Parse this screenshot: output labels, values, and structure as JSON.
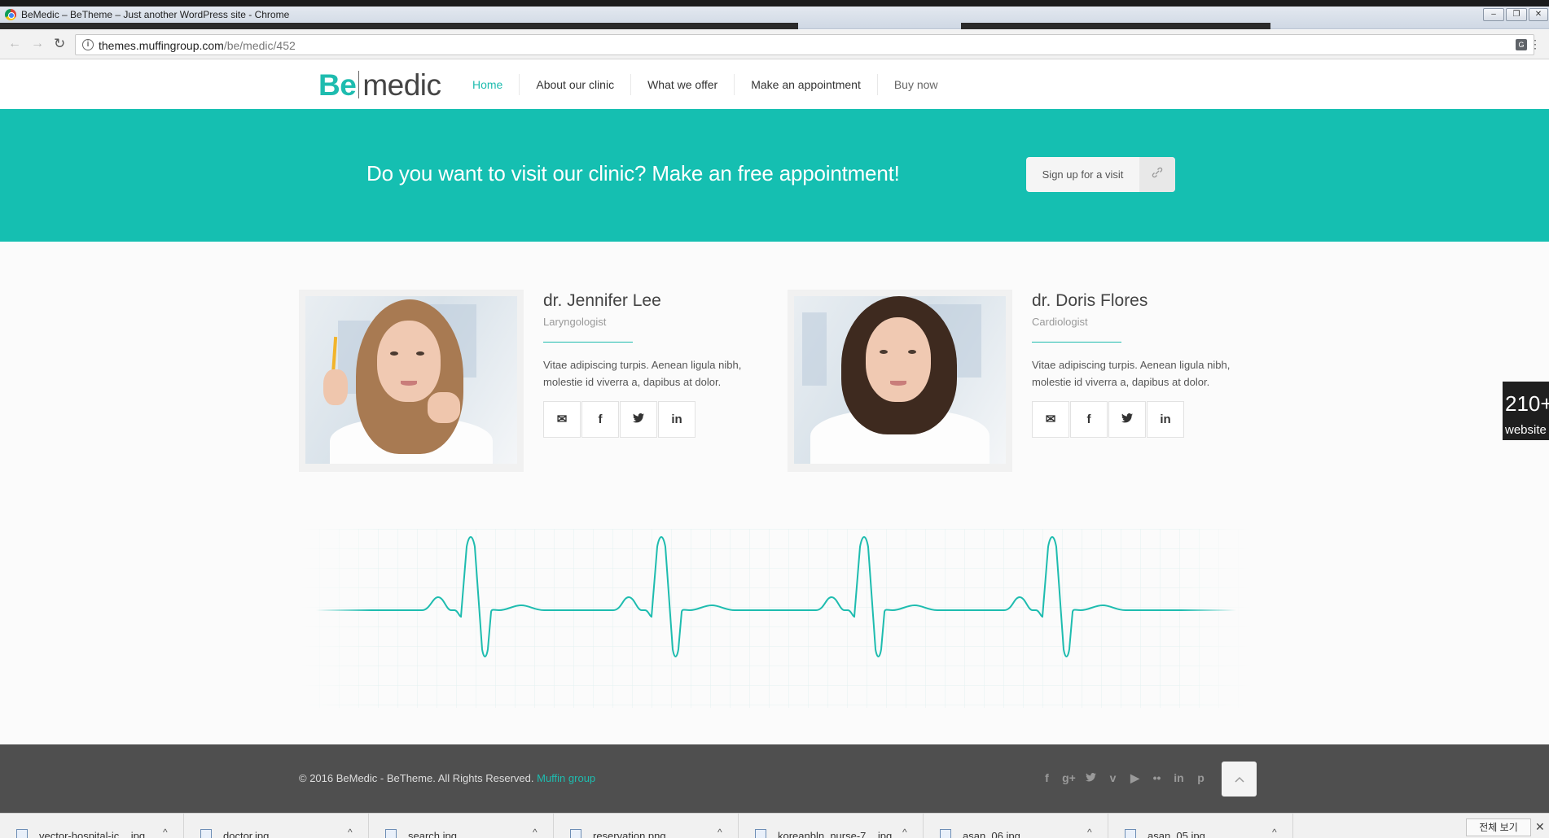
{
  "window": {
    "title": "BeMedic – BeTheme – Just another WordPress site - Chrome",
    "url_host": "themes.muffingroup.com",
    "url_path": "/be/medic/452"
  },
  "header": {
    "logo_be": "Be",
    "logo_medic": "medic",
    "menu": [
      {
        "label": "Home"
      },
      {
        "label": "About our clinic"
      },
      {
        "label": "What we offer"
      },
      {
        "label": "Make an appointment"
      },
      {
        "label": "Buy now"
      }
    ]
  },
  "cta": {
    "text": "Do you want to visit our clinic? Make an free appointment!",
    "button_label": "Sign up for a visit",
    "button_icon": "link-icon"
  },
  "doctors": [
    {
      "name": "dr. Jennifer Lee",
      "role": "Laryngologist",
      "description": "Vitae adipiscing turpis. Aenean ligula nibh, molestie id viverra a, dapibus at dolor.",
      "social": [
        "mail-icon",
        "facebook-icon",
        "twitter-icon",
        "linkedin-icon"
      ]
    },
    {
      "name": "dr. Doris Flores",
      "role": "Cardiologist",
      "description": "Vitae adipiscing turpis. Aenean ligula nibh, molestie id viverra a, dapibus at dolor.",
      "social": [
        "mail-icon",
        "facebook-icon",
        "twitter-icon",
        "linkedin-icon"
      ]
    }
  ],
  "side_badge": {
    "count": "210+",
    "label": "website"
  },
  "footer": {
    "copyright": "© 2016 BeMedic - BeTheme. All Rights Reserved.",
    "copyright_link": "Muffin group",
    "social": [
      "facebook-icon",
      "google-plus-icon",
      "twitter-icon",
      "vimeo-icon",
      "youtube-icon",
      "flickr-icon",
      "linkedin-icon",
      "pinterest-icon"
    ]
  },
  "downloads": [
    {
      "name": "vector-hospital-ic....jpg"
    },
    {
      "name": "doctor.jpg"
    },
    {
      "name": "search.jpg"
    },
    {
      "name": "reservation.png"
    },
    {
      "name": "koreanbln_nurse-7....jpg"
    },
    {
      "name": "asan_06.jpg"
    },
    {
      "name": "asan_05.jpg"
    }
  ],
  "show_all_label": "전체 보기",
  "colors": {
    "accent": "#1ebcaf",
    "cta_band": "#15bfb1",
    "footer": "#4f4f4f"
  }
}
